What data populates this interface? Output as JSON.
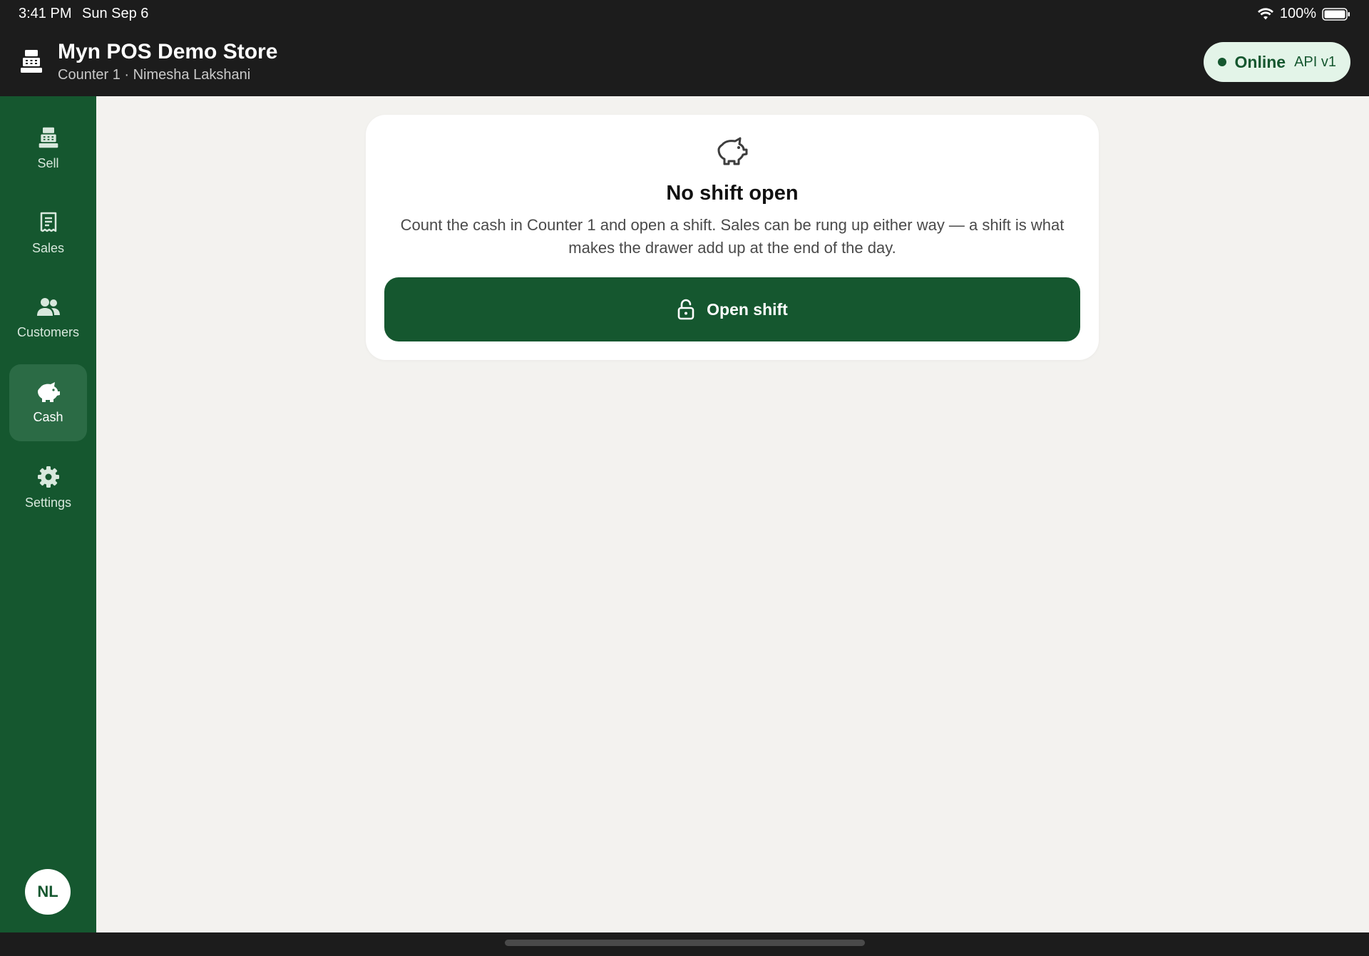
{
  "status_bar": {
    "time": "3:41 PM",
    "date": "Sun Sep 6",
    "battery": "100%"
  },
  "header": {
    "store_name": "Myn POS Demo Store",
    "subtitle": "Counter 1 · Nimesha Lakshani",
    "connection": {
      "label": "Online",
      "api": "API v1"
    }
  },
  "sidebar": {
    "items": [
      {
        "label": "Sell",
        "icon": "register-icon",
        "active": false
      },
      {
        "label": "Sales",
        "icon": "receipt-icon",
        "active": false
      },
      {
        "label": "Customers",
        "icon": "users-icon",
        "active": false
      },
      {
        "label": "Cash",
        "icon": "piggy-bank-icon",
        "active": true
      },
      {
        "label": "Settings",
        "icon": "gear-icon",
        "active": false
      }
    ],
    "avatar_initials": "NL"
  },
  "main": {
    "card": {
      "icon": "piggy-bank-icon",
      "title": "No shift open",
      "text": "Count the cash in Counter 1 and open a shift. Sales can be rung up either way — a shift is what makes the drawer add up at the end of the day.",
      "button_label": "Open shift",
      "button_icon": "unlock-icon"
    }
  },
  "colors": {
    "brand_green": "#15572f",
    "active_nav": "#2b6b45",
    "online_pill": "#e3f4e8",
    "topbar": "#1c1c1c",
    "background": "#f3f2ef"
  }
}
